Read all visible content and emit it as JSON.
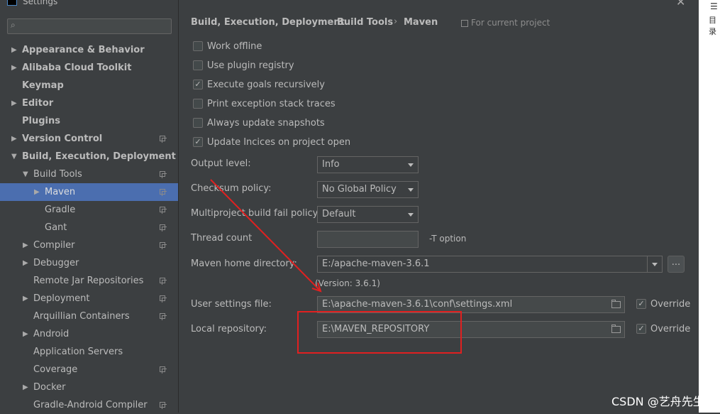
{
  "window": {
    "title": "Settings",
    "close_glyph": "✕"
  },
  "outside": {
    "icon": "☰",
    "label": "目录"
  },
  "sidebar": {
    "search_placeholder": "",
    "items": [
      {
        "label": "Appearance & Behavior",
        "arrow": "▶",
        "bold": true
      },
      {
        "label": "Alibaba Cloud Toolkit",
        "arrow": "▶",
        "bold": true
      },
      {
        "label": "Keymap",
        "bold": true
      },
      {
        "label": "Editor",
        "arrow": "▶",
        "bold": true
      },
      {
        "label": "Plugins",
        "bold": true
      },
      {
        "label": "Version Control",
        "arrow": "▶",
        "bold": true
      },
      {
        "label": "Build, Execution, Deployment",
        "arrow": "▼",
        "bold": true
      },
      {
        "label": "Build Tools",
        "arrow": "▼"
      },
      {
        "label": "Maven",
        "arrow": "▶",
        "selected": true
      },
      {
        "label": "Gradle"
      },
      {
        "label": "Gant"
      },
      {
        "label": "Compiler",
        "arrow": "▶"
      },
      {
        "label": "Debugger",
        "arrow": "▶"
      },
      {
        "label": "Remote Jar Repositories"
      },
      {
        "label": "Deployment",
        "arrow": "▶"
      },
      {
        "label": "Arquillian Containers"
      },
      {
        "label": "Android",
        "arrow": "▶"
      },
      {
        "label": "Application Servers"
      },
      {
        "label": "Coverage"
      },
      {
        "label": "Docker",
        "arrow": "▶"
      },
      {
        "label": "Gradle-Android Compiler"
      }
    ]
  },
  "breadcrumb": {
    "part1": "Build, Execution, Deployment",
    "sep": "›",
    "part2": "Build Tools",
    "part3": "Maven",
    "scope": "For current project"
  },
  "checkboxes": {
    "work_offline": {
      "label": "Work offline",
      "checked": false
    },
    "plugin_registry": {
      "label": "Use plugin registry",
      "checked": false
    },
    "execute_goals": {
      "label": "Execute goals recursively",
      "checked": true
    },
    "print_exception": {
      "label": "Print exception stack traces",
      "checked": false
    },
    "always_update": {
      "label": "Always update snapshots",
      "checked": false
    },
    "update_indices": {
      "label": "Update Incices on project open",
      "checked": true
    }
  },
  "check_glyph": "✓",
  "fields": {
    "output_level": {
      "label": "Output level:",
      "value": "Info"
    },
    "checksum_policy": {
      "label": "Checksum policy:",
      "value": "No Global Policy"
    },
    "fail_policy": {
      "label": "Multiproject build fail policy:",
      "value": "Default"
    },
    "thread_count": {
      "label": "Thread count",
      "value": "",
      "hint": "-T option"
    },
    "maven_home": {
      "label": "Maven home directory:",
      "value": "E:/apache-maven-3.6.1",
      "version": "(Version: 3.6.1)",
      "browse": "..."
    },
    "user_settings": {
      "label": "User settings file:",
      "value": "E:\\apache-maven-3.6.1\\conf\\settings.xml",
      "override": "Override"
    },
    "local_repo": {
      "label": "Local repository:",
      "value": "E:\\MAVEN_REPOSITORY",
      "override": "Override"
    }
  },
  "watermark": "CSDN @艺舟先生",
  "colors": {
    "background": "#3c3f41",
    "selection": "#4b6eaf",
    "annotation": "#e02020"
  }
}
